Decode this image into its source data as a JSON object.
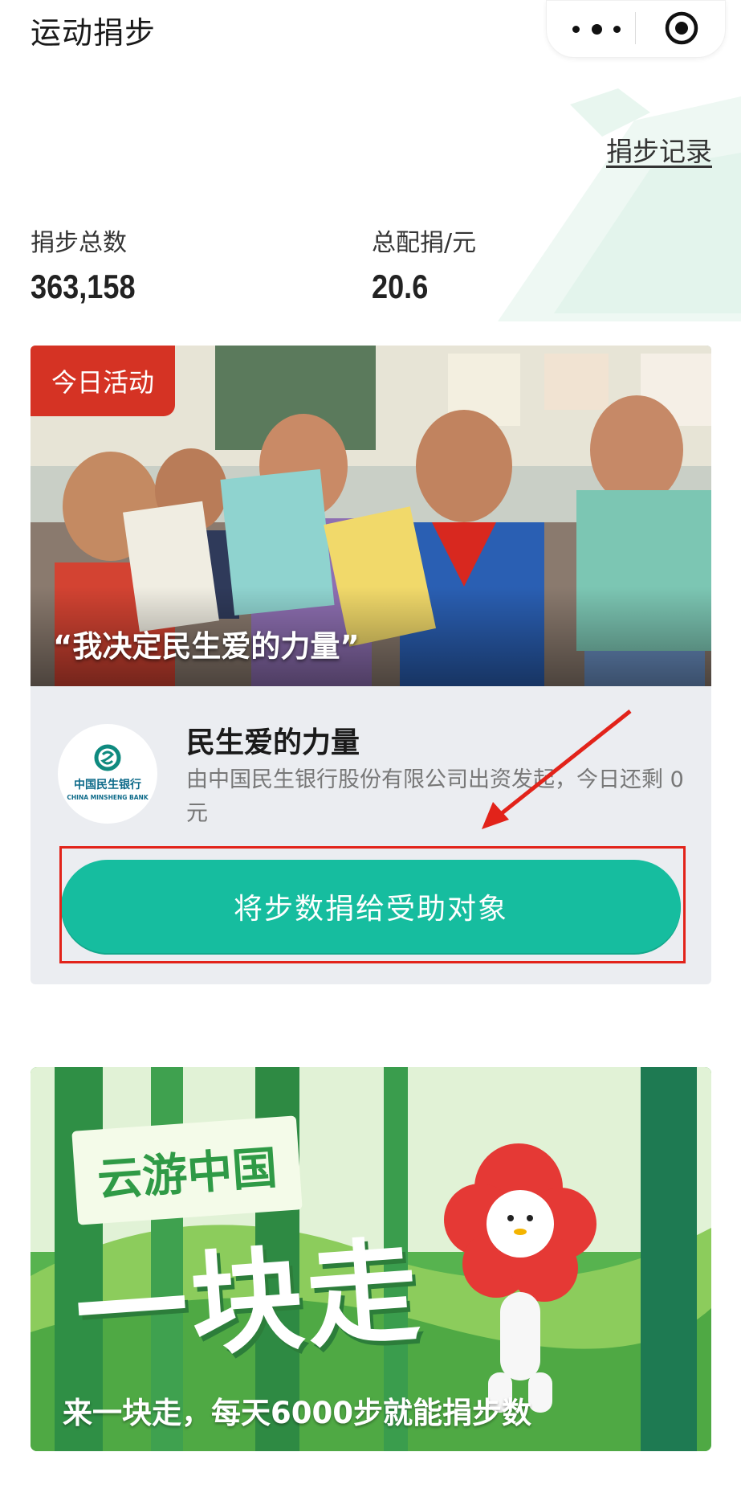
{
  "app": {
    "title": "运动捐步"
  },
  "header": {
    "record_link": "捐步记录",
    "stats": [
      {
        "label": "捐步总数",
        "value": "363,158"
      },
      {
        "label": "总配捐/元",
        "value": "20.6"
      }
    ]
  },
  "activity": {
    "badge": "今日活动",
    "caption": "“我决定民生爱的力量”",
    "org_title": "民生爱的力量",
    "org_desc": "由中国民生银行股份有限公司出资发起，今日还剩 0 元",
    "logo_text_cn": "中国民生银行",
    "logo_text_en": "CHINA MINSHENG BANK",
    "donate_button": "将步数捐给受助对象"
  },
  "promo": {
    "tag": "云游中国",
    "headline": "一块走",
    "subtitle": "来一块走，每天6000步就能捐步数"
  },
  "colors": {
    "accent": "#16bd9f",
    "badge_red": "#d53324",
    "highlight_red": "#e2231a",
    "card_bg": "#ebedf1"
  },
  "icons": [
    "more-icon",
    "target-icon"
  ]
}
